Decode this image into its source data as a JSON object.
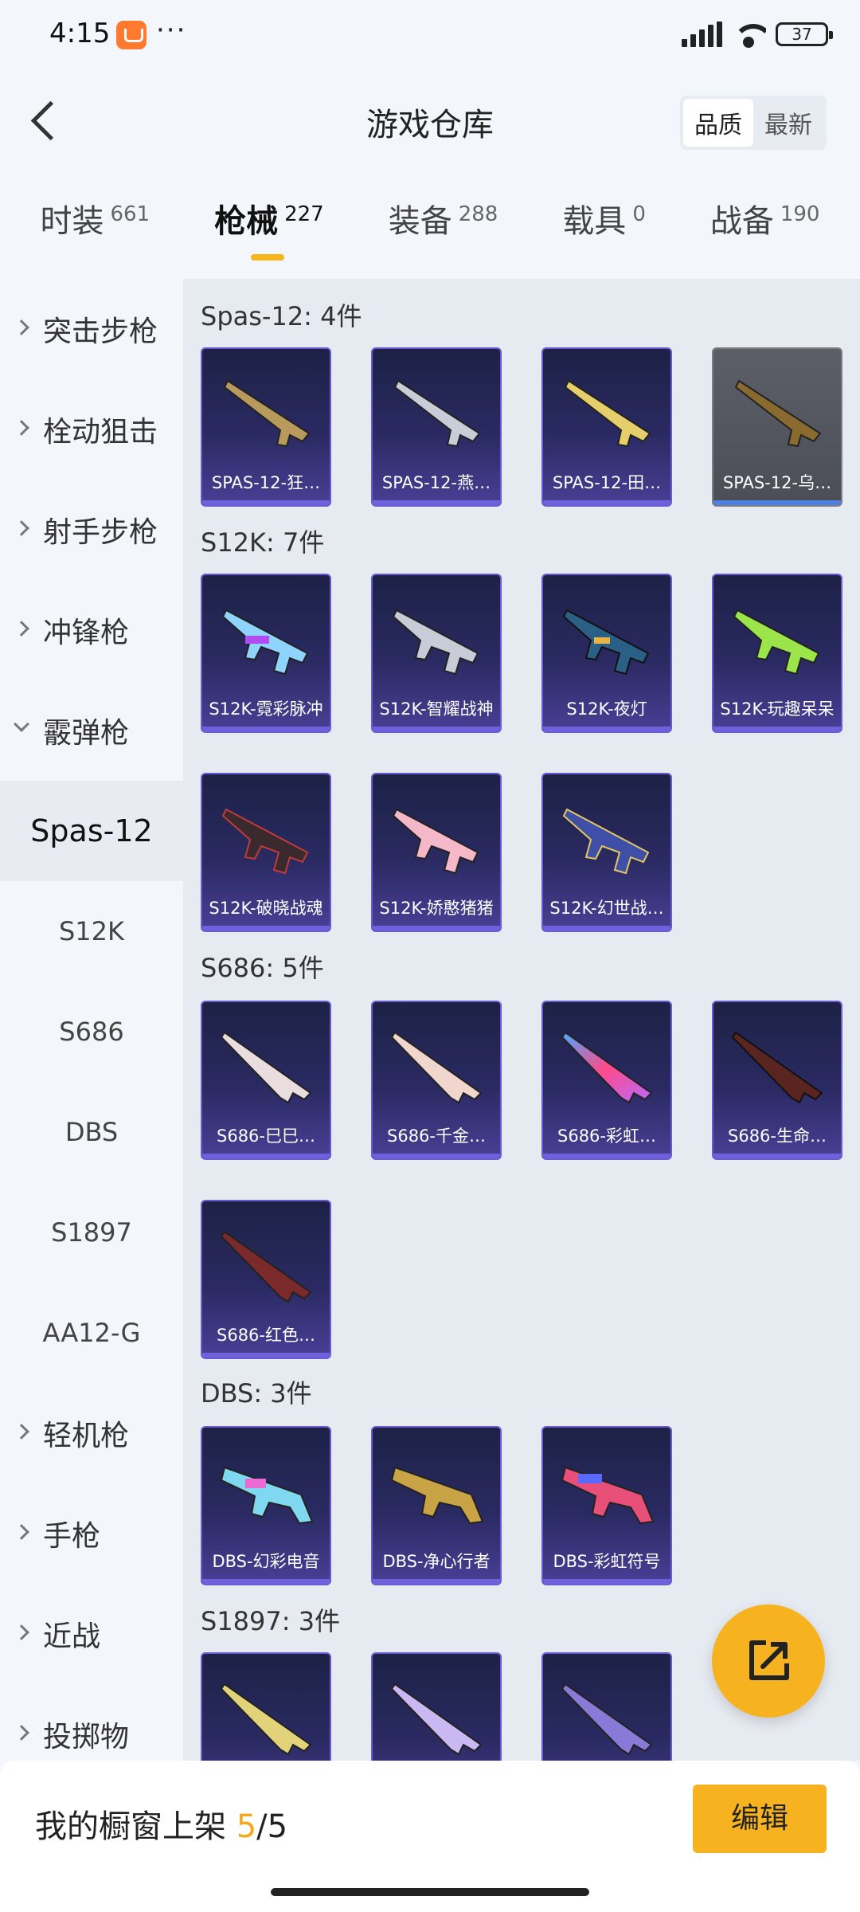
{
  "status_bar": {
    "time": "4:15",
    "battery": "37"
  },
  "header": {
    "title": "游戏仓库",
    "sort_quality": "品质",
    "sort_newest": "最新"
  },
  "tabs": [
    {
      "label": "时装",
      "count": "661"
    },
    {
      "label": "枪械",
      "count": "227"
    },
    {
      "label": "装备",
      "count": "288"
    },
    {
      "label": "载具",
      "count": "0"
    },
    {
      "label": "战备",
      "count": "190"
    }
  ],
  "sidebar": {
    "cat1": "突击步枪",
    "cat2": "栓动狙击",
    "cat3": "射手步枪",
    "cat4": "冲锋枪",
    "cat5": "霰弹枪",
    "sub1": "Spas-12",
    "sub2": "S12K",
    "sub3": "S686",
    "sub4": "DBS",
    "sub5": "S1897",
    "sub6": "AA12-G",
    "cat6": "轻机枪",
    "cat7": "手枪",
    "cat8": "近战",
    "cat9": "投掷物"
  },
  "groups": {
    "spas": {
      "title": "Spas-12: 4件",
      "items": [
        "SPAS-12-狂…",
        "SPAS-12-燕…",
        "SPAS-12-田…",
        "SPAS-12-乌…"
      ]
    },
    "s12k": {
      "title": "S12K: 7件",
      "items": [
        "S12K-霓彩脉冲",
        "S12K-智耀战神",
        "S12K-夜灯",
        "S12K-玩趣呆呆",
        "S12K-破晓战魂",
        "S12K-娇憨猪猪",
        "S12K-幻世战…"
      ]
    },
    "s686": {
      "title": "S686: 5件",
      "items": [
        "S686-巳巳…",
        "S686-千金…",
        "S686-彩虹…",
        "S686-生命…",
        "S686-红色…"
      ]
    },
    "dbs": {
      "title": "DBS: 3件",
      "items": [
        "DBS-幻彩电音",
        "DBS-净心行者",
        "DBS-彩虹符号"
      ]
    },
    "s1897": {
      "title": "S1897: 3件"
    }
  },
  "bottom": {
    "label": "我的橱窗上架 ",
    "count": "5",
    "total": "/5",
    "edit": "编辑"
  },
  "colors": {
    "accent": "#f6b31f",
    "card_top": "#1d2145",
    "card_bottom": "#4a3f96"
  }
}
